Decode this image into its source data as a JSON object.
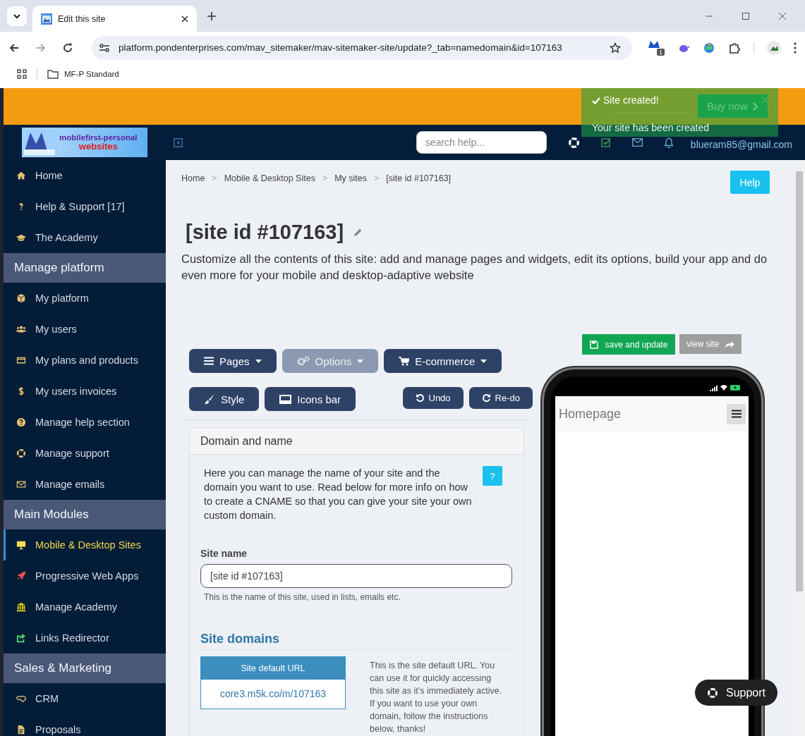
{
  "browser": {
    "tab_title": "Edit this site",
    "url": "platform.pondenterprises.com/mav_sitemaker/mav-sitemaker-site/update?_tab=namedomain&id=107163",
    "extension_badge": "1",
    "bookmarks": [
      "MF-P Standard"
    ]
  },
  "top_bar": {
    "buy_now": "Buy now"
  },
  "toast": {
    "title": "Site created!",
    "message": "Your site has been created"
  },
  "header": {
    "logo_line_1": "mobilefirst-personal",
    "logo_line_2": "websites",
    "search": {
      "placeholder": "search help..."
    },
    "user_email": "blueram85@gmail.com"
  },
  "sidebar": {
    "groups": [
      {
        "items": [
          {
            "label": "Home",
            "selected": false
          },
          {
            "label": "Help & Support [17]",
            "selected": false
          },
          {
            "label": "The Academy",
            "selected": false
          }
        ]
      },
      {
        "heading": "Manage platform",
        "items": [
          {
            "label": "My platform",
            "selected": false
          },
          {
            "label": "My users",
            "selected": false
          },
          {
            "label": "My plans and products",
            "selected": false
          },
          {
            "label": "My users invoices",
            "selected": false
          },
          {
            "label": "Manage help section",
            "selected": false
          },
          {
            "label": "Manage support",
            "selected": false
          },
          {
            "label": "Manage emails",
            "selected": false
          }
        ]
      },
      {
        "heading": "Main Modules",
        "items": [
          {
            "label": "Mobile & Desktop Sites",
            "selected": true
          },
          {
            "label": "Progressive Web Apps",
            "selected": false
          },
          {
            "label": "Manage Academy",
            "selected": false
          },
          {
            "label": "Links Redirector",
            "selected": false
          }
        ]
      },
      {
        "heading": "Sales & Marketing",
        "items": [
          {
            "label": "CRM",
            "selected": false
          },
          {
            "label": "Proposals",
            "selected": false
          }
        ]
      }
    ]
  },
  "breadcrumb": [
    {
      "label": "Home"
    },
    {
      "separator": ">",
      "label": "Mobile & Desktop Sites"
    },
    {
      "separator": ">",
      "label": "My sites"
    },
    {
      "separator": ">",
      "label": "[site id #107163]"
    }
  ],
  "help_button": "Help",
  "title": "[site id #107163]",
  "description": "Customize all the contents of this site: add and manage pages and widgets, edit its options, build your app and do even more for your mobile and desktop-adaptive website",
  "menu_buttons": [
    {
      "label": "Pages",
      "selected": false
    },
    {
      "label": "Options",
      "selected": true
    },
    {
      "label": "E-commerce",
      "selected": false
    }
  ],
  "tool_buttons": [
    "Style",
    "Icons bar"
  ],
  "history_buttons": [
    "Undo",
    "Re-do"
  ],
  "panel": {
    "heading": "Domain and name",
    "intro": "Here you can manage the name of your site and the domain you want to use. Read below for more info on how to create a CNAME so that you can give your site your own custom domain.",
    "info_button": "?",
    "site_name": {
      "label": "Site name",
      "value": "[site id #107163]",
      "hint": "This is the name of this site, used in lists, emails etc."
    },
    "domains_heading": "Site domains",
    "default_url": {
      "heading": "Site default URL",
      "link": "core3.m5k.co/m/107163",
      "note": "This is the site default URL. You can use it for quickly accessing this site as it's immediately active. If you want to use your own domain, follow the instructions below, thanks!"
    }
  },
  "preview": {
    "save": "save and update",
    "view": "view site",
    "page_title": "Homepage"
  },
  "support": "Support"
}
